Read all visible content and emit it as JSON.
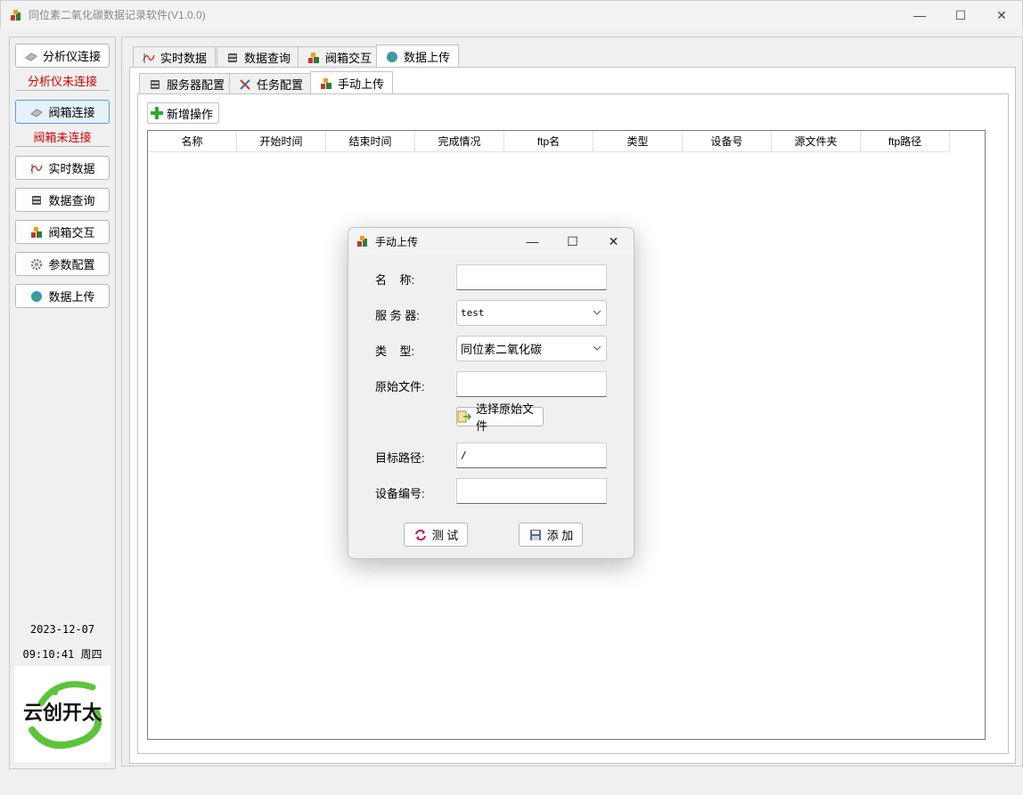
{
  "window": {
    "title": "同位素二氧化碳数据记录软件(V1.0.0)",
    "minimize": "—",
    "maximize": "☐",
    "close": "✕"
  },
  "sidebar": {
    "analyzer_button": "分析仪连接",
    "analyzer_status": "分析仪未连接",
    "valve_button": "阀箱连接",
    "valve_status": "阀箱未连接",
    "nav": [
      {
        "label": "实时数据",
        "icon": "wave-chart-icon"
      },
      {
        "label": "数据查询",
        "icon": "database-icon"
      },
      {
        "label": "阀箱交互",
        "icon": "blocks-icon"
      },
      {
        "label": "参数配置",
        "icon": "gear-icon"
      },
      {
        "label": "数据上传",
        "icon": "globe-icon"
      }
    ],
    "date": "2023-12-07",
    "time": "09:10:41 周四",
    "logo_text": "云创开太"
  },
  "tabs": {
    "main": [
      "实时数据",
      "数据查询",
      "阀箱交互",
      "数据上传"
    ],
    "sub": [
      "服务器配置",
      "任务配置",
      "手动上传"
    ]
  },
  "toolbar": {
    "add_label": "新增操作"
  },
  "table": {
    "columns": [
      "名称",
      "开始时间",
      "结束时间",
      "完成情况",
      "ftp名",
      "类型",
      "设备号",
      "源文件夹",
      "ftp路径"
    ]
  },
  "dialog": {
    "title": "手动上传",
    "name_label": "名    称:",
    "name_value": "",
    "server_label": "服 务 器:",
    "server_value": "test",
    "type_label": "类    型:",
    "type_value": "同位素二氧化碳",
    "source_label": "原始文件:",
    "source_value": "",
    "choose_button": "选择原始文件",
    "target_label": "目标路径:",
    "target_value": "/",
    "device_label": "设备编号:",
    "device_value": "",
    "test_button": "测  试",
    "add_button": "添  加"
  },
  "colors": {
    "status_red": "#d40000",
    "active_border": "#5a9bd5",
    "logo_green": "#5cc43a"
  }
}
